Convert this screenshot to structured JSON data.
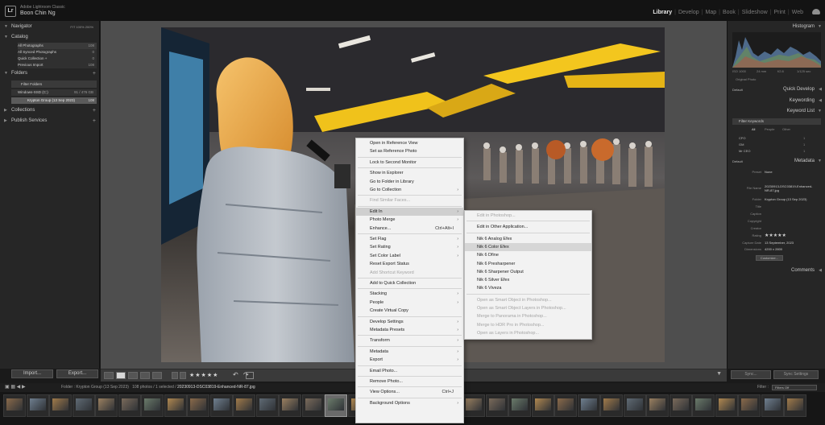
{
  "app": {
    "name": "Adobe Lightroom Classic",
    "user": "Boon Chin Ng",
    "modules": [
      "Library",
      "Develop",
      "Map",
      "Book",
      "Slideshow",
      "Print",
      "Web"
    ],
    "active_module": "Library"
  },
  "left_panel": {
    "navigator_label": "Navigator",
    "navigator_options": "FIT  100%  200%",
    "catalog_label": "Catalog",
    "catalog_items": [
      {
        "label": "All Photographs",
        "count": "108"
      },
      {
        "label": "All Synced Photographs",
        "count": "0"
      },
      {
        "label": "Quick Collection +",
        "count": "0"
      },
      {
        "label": "Previous Import",
        "count": "108"
      }
    ],
    "folders_label": "Folders",
    "filter_folders": "Filter Folders",
    "volume": {
      "label": "Windows-SSD (C:)",
      "count": "91 / 476 GB"
    },
    "folder": {
      "label": "Krypton Group (13 Sep 2023)",
      "count": "108"
    },
    "collections_label": "Collections",
    "publish_label": "Publish Services",
    "import_label": "Import...",
    "export_label": "Export..."
  },
  "toolbar": {
    "stars": "★★★★★"
  },
  "right_panel": {
    "histogram_label": "Histogram",
    "histogram_info": [
      "ISO 1000",
      "24 mm",
      "f/2.8",
      "1/125 sec"
    ],
    "original_photo": "Original Photo",
    "quick_develop_label": "Quick Develop",
    "quick_develop_preset": "Default",
    "keywording_label": "Keywording",
    "keyword_list_label": "Keyword List",
    "filter_keywords": "Filter Keywords",
    "keyword_tabs": [
      "All",
      "People",
      "Other"
    ],
    "keywords": [
      {
        "label": "CFO",
        "count": "1"
      },
      {
        "label": "GM",
        "count": "1"
      },
      {
        "label": "Mr CEO",
        "count": "1"
      }
    ],
    "metadata_label": "Metadata",
    "metadata_preset_select": "Default",
    "metadata_fields": [
      {
        "label": "Preset",
        "value": "None"
      },
      {
        "label": "File Name",
        "value": "20230913-DSC03819-Enhanced-NR-87.jpg"
      },
      {
        "label": "Folder",
        "value": "Krypton Group (13 Sep 2023)"
      },
      {
        "label": "Title",
        "value": ""
      },
      {
        "label": "Caption",
        "value": ""
      },
      {
        "label": "Copyright",
        "value": ""
      },
      {
        "label": "Creator",
        "value": ""
      },
      {
        "label": "Rating",
        "value": "★★★★★"
      },
      {
        "label": "Capture Date",
        "value": "13 September, 2023"
      },
      {
        "label": "Dimensions",
        "value": "4200 x 2800"
      }
    ],
    "customize_label": "Customize...",
    "comments_label": "Comments",
    "sync_label": "Sync...",
    "sync_settings_label": "Sync Settings"
  },
  "filmstrip_bar": {
    "folder_path": "Folder : Krypton Group (13 Sep 2023)",
    "count_text": "108 photos / 1 selected /",
    "selected_file": "20230913-DSC03819-Enhanced-NR-87.jpg",
    "filter_label": "Filter :",
    "filter_value": "Filters Off"
  },
  "context_menu": {
    "items": [
      {
        "label": "Open in Reference View",
        "disabled": false
      },
      {
        "label": "Set as Reference Photo",
        "disabled": false
      },
      {
        "sep": true
      },
      {
        "label": "Lock to Second Monitor",
        "disabled": false
      },
      {
        "sep": true
      },
      {
        "label": "Show in Explorer",
        "disabled": false
      },
      {
        "label": "Go to Folder in Library",
        "disabled": false
      },
      {
        "label": "Go to Collection",
        "disabled": false,
        "submenu": true
      },
      {
        "sep": true
      },
      {
        "label": "Find Similar Faces...",
        "disabled": true
      },
      {
        "sep": true
      },
      {
        "label": "Edit In",
        "disabled": false,
        "submenu": true,
        "highlighted": true
      },
      {
        "label": "Photo Merge",
        "disabled": false,
        "submenu": true
      },
      {
        "label": "Enhance...",
        "disabled": false,
        "shortcut": "Ctrl+Alt+I"
      },
      {
        "sep": true
      },
      {
        "label": "Set Flag",
        "disabled": false,
        "submenu": true
      },
      {
        "label": "Set Rating",
        "disabled": false,
        "submenu": true
      },
      {
        "label": "Set Color Label",
        "disabled": false,
        "submenu": true
      },
      {
        "label": "Reset Export Status",
        "disabled": false
      },
      {
        "label": "Add Shortcut Keyword",
        "disabled": true
      },
      {
        "sep": true
      },
      {
        "label": "Add to Quick Collection",
        "disabled": false
      },
      {
        "sep": true
      },
      {
        "label": "Stacking",
        "disabled": false,
        "submenu": true
      },
      {
        "label": "People",
        "disabled": false,
        "submenu": true
      },
      {
        "label": "Create Virtual Copy",
        "disabled": false
      },
      {
        "sep": true
      },
      {
        "label": "Develop Settings",
        "disabled": false,
        "submenu": true
      },
      {
        "label": "Metadata Presets",
        "disabled": false,
        "submenu": true
      },
      {
        "sep": true
      },
      {
        "label": "Transform",
        "disabled": false,
        "submenu": true
      },
      {
        "sep": true
      },
      {
        "label": "Metadata",
        "disabled": false,
        "submenu": true
      },
      {
        "label": "Export",
        "disabled": false,
        "submenu": true
      },
      {
        "sep": true
      },
      {
        "label": "Email Photo...",
        "disabled": false
      },
      {
        "sep": true
      },
      {
        "label": "Remove Photo...",
        "disabled": false
      },
      {
        "sep": true
      },
      {
        "label": "View Options...",
        "disabled": false,
        "shortcut": "Ctrl+J"
      },
      {
        "sep": true
      },
      {
        "label": "Background Options",
        "disabled": false,
        "submenu": true
      }
    ]
  },
  "edit_in_submenu": {
    "items": [
      {
        "label": "Edit in Photoshop...",
        "disabled": true
      },
      {
        "sep": true
      },
      {
        "label": "Edit in Other Application...",
        "disabled": false
      },
      {
        "sep": true
      },
      {
        "label": "Nik 6 Analog Efex",
        "disabled": false
      },
      {
        "label": "Nik 6 Color Efex",
        "disabled": false,
        "highlighted": true
      },
      {
        "label": "Nik 6 Dfine",
        "disabled": false
      },
      {
        "label": "Nik 6 Presharpener",
        "disabled": false
      },
      {
        "label": "Nik 6 Sharpener Output",
        "disabled": false
      },
      {
        "label": "Nik 6 Silver Efex",
        "disabled": false
      },
      {
        "label": "Nik 6 Viveza",
        "disabled": false
      },
      {
        "sep": true
      },
      {
        "label": "Open as Smart Object in Photoshop...",
        "disabled": true
      },
      {
        "label": "Open as Smart Object Layers in Photoshop...",
        "disabled": true
      },
      {
        "label": "Merge to Panorama in Photoshop...",
        "disabled": true
      },
      {
        "label": "Merge to HDR Pro in Photoshop...",
        "disabled": true
      },
      {
        "label": "Open as Layers in Photoshop...",
        "disabled": true
      }
    ]
  }
}
